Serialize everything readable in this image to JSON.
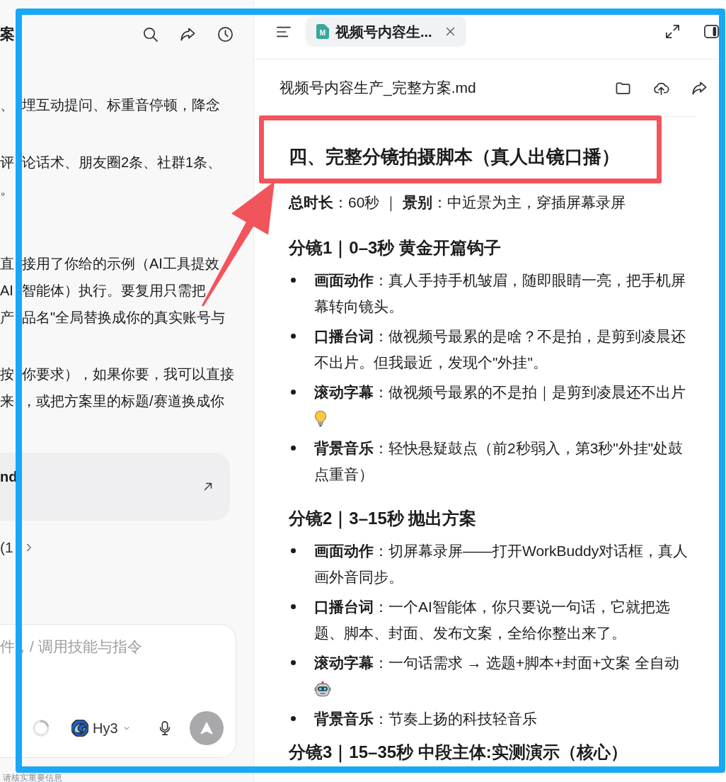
{
  "chat_panel": {
    "title": "案",
    "paragraphs": [
      {
        "lines": [
          "、埋互动提问、标重音停顿，降念"
        ]
      },
      {
        "lines": [
          "评论话术、朋友圈2条、社群1条、",
          "。"
        ]
      },
      {
        "lines": [
          "直接用了你给的示例（AI工具提效",
          "AI智能体）执行。要复用只需把",
          "产品名\"全局替换成你的真实账号与"
        ]
      },
      {
        "lines": [
          "按你要求），如果你要，我可以直接",
          "来，或把方案里的标题/赛道换成你"
        ]
      }
    ],
    "file_card": {
      "name": "nd"
    },
    "expand_row": {
      "label": "(1"
    },
    "composer": {
      "placeholder": "件，/ 调用技能与指令",
      "model": "Hy3",
      "send_disabled": true
    },
    "footer_note": "请核实重要信息"
  },
  "preview_panel": {
    "tabs": [
      {
        "title": "视频号内容生...",
        "file_letter": "M",
        "selected": true
      }
    ],
    "file_name": "视频号内容生产_完整方案.md",
    "heading": "四、完整分镜拍摄脚本（真人出镜口播）",
    "meta": "**总时长**：60秒 ｜ **景别**：中近景为主，穿插屏幕录屏",
    "shots": [
      {
        "title": "分镜1｜0–3秒 黄金开篇钩子",
        "items": [
          {
            "kind": "text",
            "text": "**画面动作**：真人手持手机皱眉，随即眼睛一亮，把手机屏幕转向镜头。"
          },
          {
            "kind": "text",
            "text": "**口播台词**：做视频号最累的是啥？不是拍，是剪到凌晨还不出片。但我最近，发现个\"外挂\"。"
          },
          {
            "kind": "emoji",
            "text": "**滚动字幕**：做视频号最累的不是拍｜是剪到凌晨还不出片"
          },
          {
            "kind": "text",
            "text": "**背景音乐**：轻快悬疑鼓点（前2秒弱入，第3秒\"外挂\"处鼓点重音）"
          }
        ]
      },
      {
        "title": "分镜2｜3–15秒 抛出方案",
        "items": [
          {
            "kind": "text",
            "text": "**画面动作**：切屏幕录屏——打开WorkBuddy对话框，真人画外音同步。"
          },
          {
            "kind": "text",
            "text": "**口播台词**：一个AI智能体，你只要说一句话，它就把选题、脚本、封面、发布文案，全给你整出来了。"
          },
          {
            "kind": "emoji",
            "text": "**滚动字幕**：一句话需求 → 选题+脚本+封面+文案 全自动"
          },
          {
            "kind": "text",
            "text": "**背景音乐**：节奏上扬的科技轻音乐"
          }
        ]
      },
      {
        "title": "分镜3｜15–35秒 中段主体:实测演示（核心）"
      }
    ]
  },
  "annotations": [
    {
      "kind": "frame",
      "color": "#1aa8f6"
    },
    {
      "kind": "box",
      "color": "#f2545b"
    },
    {
      "kind": "arrow",
      "color": "#f2545b"
    }
  ]
}
